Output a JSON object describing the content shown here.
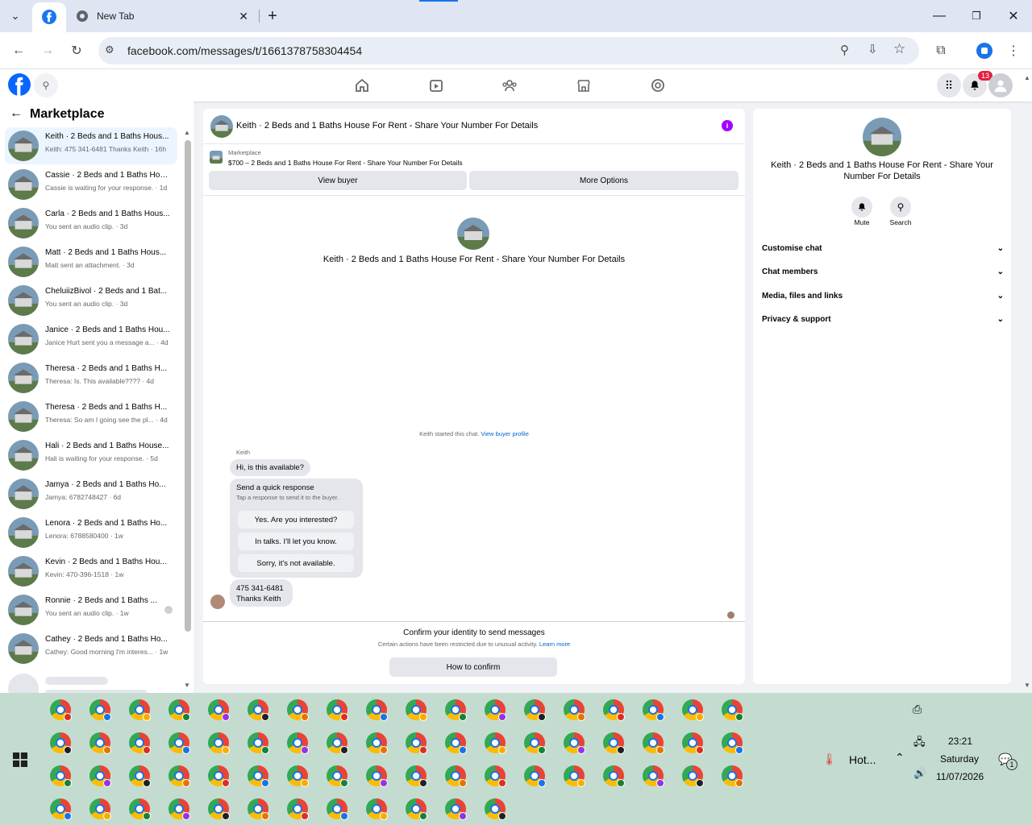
{
  "browser": {
    "tab_title": "New Tab",
    "url": "facebook.com/messages/t/1661378758304454"
  },
  "fb": {
    "notification_count": "13"
  },
  "left": {
    "title": "Marketplace",
    "conversations": [
      {
        "name": "Keith · 2 Beds and 1 Baths Hous...",
        "preview": "Keith: 475 341-6481 Thanks Keith · 16h"
      },
      {
        "name": "Cassie · 2 Beds and 1 Baths Hou...",
        "preview": "Cassie is waiting for your response. · 1d"
      },
      {
        "name": "Carla · 2 Beds and 1 Baths Hous...",
        "preview": "You sent an audio clip. · 3d"
      },
      {
        "name": "Matt · 2 Beds and 1 Baths Hous...",
        "preview": "Matt sent an attachment. · 3d"
      },
      {
        "name": "CheluiizBivol · 2 Beds and 1 Bat...",
        "preview": "You sent an audio clip. · 3d"
      },
      {
        "name": "Janice · 2 Beds and 1 Baths Hou...",
        "preview": "Janice Hurt sent you a message a... · 4d"
      },
      {
        "name": "Theresa · 2 Beds and 1 Baths H...",
        "preview": "Theresa: Is. This available???? · 4d"
      },
      {
        "name": "Theresa · 2 Beds and 1 Baths H...",
        "preview": "Theresa: So am I going see the pl... · 4d"
      },
      {
        "name": "Hali · 2 Beds and 1 Baths House...",
        "preview": "Hali is waiting for your response. · 5d"
      },
      {
        "name": "Jamya · 2 Beds and 1 Baths Ho...",
        "preview": "Jamya: 6782748427 · 6d"
      },
      {
        "name": "Lenora · 2 Beds and 1 Baths Ho...",
        "preview": "Lenora: 6788580400 · 1w"
      },
      {
        "name": "Kevin · 2 Beds and 1 Baths Hou...",
        "preview": "Kevin: 470-396-1518 · 1w"
      },
      {
        "name": "Ronnie · 2 Beds and 1 Baths ...",
        "preview": "You sent an audio clip. · 1w"
      },
      {
        "name": "Cathey · 2 Beds and 1 Baths Ho...",
        "preview": "Cathey: Good morning I'm interes... · 1w"
      }
    ]
  },
  "chat": {
    "header_title": "Keith · 2 Beds and 1 Baths House For Rent - Share Your Number For Details",
    "listing_label": "Marketplace",
    "listing_text": "$700 – 2 Beds and 1 Baths House For Rent - Share Your Number For Details",
    "view_buyer": "View buyer",
    "more_options": "More Options",
    "intro_title": "Keith · 2 Beds and 1 Baths House For Rent - Share Your Number For Details",
    "started_text": "Keith started this chat.",
    "view_buyer_profile": "View buyer profile",
    "sender_name": "Keith",
    "msg1": "Hi, is this available?",
    "quick_title": "Send a quick response",
    "quick_sub": "Tap a response to send it to the buyer.",
    "quick_responses": [
      "Yes. Are you interested?",
      "In talks. I'll let you know.",
      "Sorry, it's not available."
    ],
    "msg2_line1": "475 341-6481",
    "msg2_line2": "Thanks Keith",
    "confirm_title": "Confirm your identity to send messages",
    "confirm_sub": "Certain actions have been restricted due to unusual activity.",
    "learn_more": "Learn more",
    "how_to_confirm": "How to confirm"
  },
  "details": {
    "title": "Keith · 2 Beds and 1 Baths House For Rent - Share Your Number For Details",
    "mute": "Mute",
    "search": "Search",
    "sections": [
      "Customise chat",
      "Chat members",
      "Media, files and links",
      "Privacy & support"
    ]
  },
  "taskbar": {
    "weather": "Hot...",
    "time": "23:21",
    "day": "Saturday",
    "date": "11/07/2026",
    "notif_count": "1"
  }
}
